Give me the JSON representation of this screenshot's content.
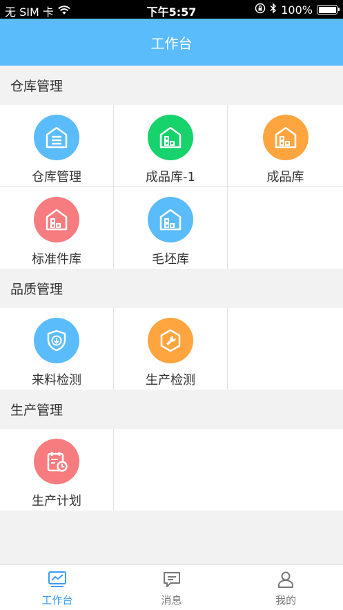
{
  "status_bar": {
    "carrier": "无 SIM 卡",
    "time": "下午5:57",
    "battery": "100%"
  },
  "header": {
    "title": "工作台"
  },
  "sections": [
    {
      "title": "仓库管理",
      "items": [
        {
          "label": "仓库管理",
          "icon": "warehouse-list-icon",
          "color": "#5bbcfb"
        },
        {
          "label": "成品库-1",
          "icon": "warehouse-boxes-icon",
          "color": "#16d36b"
        },
        {
          "label": "成品库",
          "icon": "warehouse-boxes-icon",
          "color": "#fea540"
        },
        {
          "label": "标准件库",
          "icon": "warehouse-boxes-icon",
          "color": "#f67c80"
        },
        {
          "label": "毛坯库",
          "icon": "warehouse-boxes-icon",
          "color": "#5bbcfb"
        }
      ]
    },
    {
      "title": "品质管理",
      "items": [
        {
          "label": "来料检测",
          "icon": "shield-download-icon",
          "color": "#5bbcfb"
        },
        {
          "label": "生产检测",
          "icon": "wrench-hexagon-icon",
          "color": "#fea540"
        }
      ]
    },
    {
      "title": "生产管理",
      "items": [
        {
          "label": "生产计划",
          "icon": "calendar-clock-icon",
          "color": "#f67c80"
        }
      ]
    }
  ],
  "tab_bar": {
    "tabs": [
      {
        "label": "工作台",
        "icon": "dashboard-chart-icon",
        "active": true
      },
      {
        "label": "消息",
        "icon": "message-icon",
        "active": false
      },
      {
        "label": "我的",
        "icon": "user-icon",
        "active": false
      }
    ],
    "active_color": "#3a9cf0"
  }
}
